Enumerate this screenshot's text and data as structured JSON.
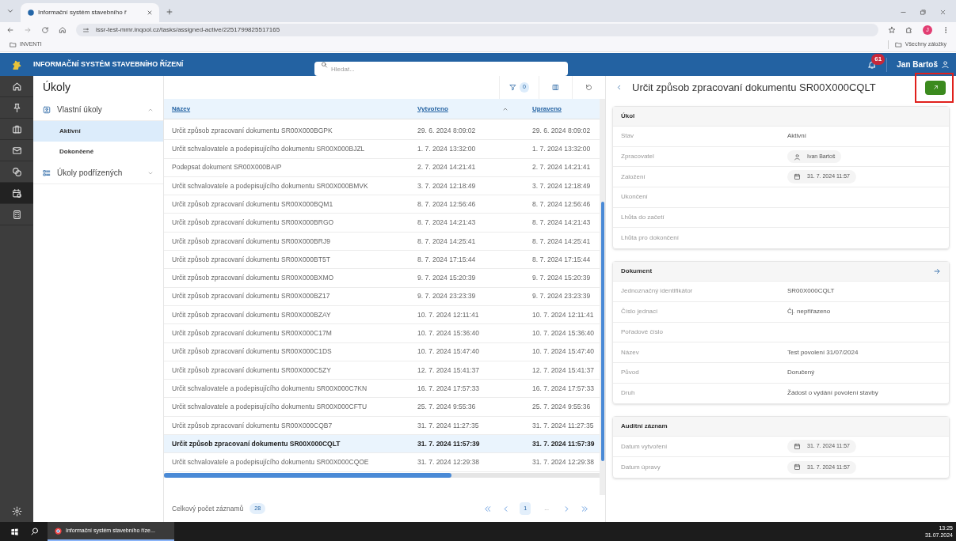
{
  "browser": {
    "tab_title": "Informační systém stavebního ř",
    "url": "issr-test-mmr.inqool.cz/tasks/assigned-active/2251799825517165",
    "bookmarks": [
      "INVENTI"
    ],
    "all_bookmarks": "Všechny záložky",
    "profile_initial": "J"
  },
  "app": {
    "title": "INFORMAČNÍ SYSTÉM STAVEBNÍHO ŘÍZENÍ",
    "search": {
      "placeholder": "Hledat..."
    },
    "notifications": "61",
    "user": "Jan Bartoš"
  },
  "rail": [
    {
      "selected": false
    },
    {
      "selected": false
    },
    {
      "selected": false
    },
    {
      "selected": false
    },
    {
      "selected": false
    },
    {
      "selected": true
    },
    {
      "selected": false
    }
  ],
  "sidebar": {
    "title": "Úkoly",
    "groups": [
      {
        "label": "Vlastní úkoly",
        "expanded": true,
        "children": [
          {
            "label": "Aktivní",
            "selected": true
          },
          {
            "label": "Dokončené",
            "selected": false
          }
        ]
      },
      {
        "label": "Úkoly podřízených",
        "expanded": false
      }
    ]
  },
  "toolbar": {
    "filter_count": "0"
  },
  "table": {
    "columns": [
      {
        "label": "Název",
        "sorted": false
      },
      {
        "label": "Vytvořeno",
        "sorted": true
      },
      {
        "label": "Upraveno",
        "sorted": false
      }
    ],
    "rows": [
      {
        "cells": [
          "Určit způsob zpracovaní dokumentu SR00X000BGPK",
          "29. 6. 2024 8:09:02",
          "29. 6. 2024 8:09:02"
        ],
        "selected": false
      },
      {
        "cells": [
          "Určit schvalovatele a podepisujícího dokumentu SR00X000BJZL",
          "1. 7. 2024 13:32:00",
          "1. 7. 2024 13:32:00"
        ],
        "selected": false
      },
      {
        "cells": [
          "Podepsat dokument SR00X000BAIP",
          "2. 7. 2024 14:21:41",
          "2. 7. 2024 14:21:41"
        ],
        "selected": false
      },
      {
        "cells": [
          "Určit schvalovatele a podepisujícího dokumentu SR00X000BMVK",
          "3. 7. 2024 12:18:49",
          "3. 7. 2024 12:18:49"
        ],
        "selected": false
      },
      {
        "cells": [
          "Určit způsob zpracovaní dokumentu SR00X000BQM1",
          "8. 7. 2024 12:56:46",
          "8. 7. 2024 12:56:46"
        ],
        "selected": false
      },
      {
        "cells": [
          "Určit způsob zpracovaní dokumentu SR00X000BRGO",
          "8. 7. 2024 14:21:43",
          "8. 7. 2024 14:21:43"
        ],
        "selected": false
      },
      {
        "cells": [
          "Určit způsob zpracovaní dokumentu SR00X000BRJ9",
          "8. 7. 2024 14:25:41",
          "8. 7. 2024 14:25:41"
        ],
        "selected": false
      },
      {
        "cells": [
          "Určit způsob zpracovaní dokumentu SR00X000BT5T",
          "8. 7. 2024 17:15:44",
          "8. 7. 2024 17:15:44"
        ],
        "selected": false
      },
      {
        "cells": [
          "Určit způsob zpracovaní dokumentu SR00X000BXMO",
          "9. 7. 2024 15:20:39",
          "9. 7. 2024 15:20:39"
        ],
        "selected": false
      },
      {
        "cells": [
          "Určit způsob zpracovaní dokumentu SR00X000BZ17",
          "9. 7. 2024 23:23:39",
          "9. 7. 2024 23:23:39"
        ],
        "selected": false
      },
      {
        "cells": [
          "Určit způsob zpracovaní dokumentu SR00X000BZAY",
          "10. 7. 2024 12:11:41",
          "10. 7. 2024 12:11:41"
        ],
        "selected": false
      },
      {
        "cells": [
          "Určit způsob zpracovaní dokumentu SR00X000C17M",
          "10. 7. 2024 15:36:40",
          "10. 7. 2024 15:36:40"
        ],
        "selected": false
      },
      {
        "cells": [
          "Určit způsob zpracovaní dokumentu SR00X000C1DS",
          "10. 7. 2024 15:47:40",
          "10. 7. 2024 15:47:40"
        ],
        "selected": false
      },
      {
        "cells": [
          "Určit způsob zpracovaní dokumentu SR00X000C5ZY",
          "12. 7. 2024 15:41:37",
          "12. 7. 2024 15:41:37"
        ],
        "selected": false
      },
      {
        "cells": [
          "Určit schvalovatele a podepisujícího dokumentu SR00X000C7KN",
          "16. 7. 2024 17:57:33",
          "16. 7. 2024 17:57:33"
        ],
        "selected": false
      },
      {
        "cells": [
          "Určit schvalovatele a podepisujícího dokumentu SR00X000CFTU",
          "25. 7. 2024 9:55:36",
          "25. 7. 2024 9:55:36"
        ],
        "selected": false
      },
      {
        "cells": [
          "Určit způsob zpracovaní dokumentu SR00X000CQB7",
          "31. 7. 2024 11:27:35",
          "31. 7. 2024 11:27:35"
        ],
        "selected": false
      },
      {
        "cells": [
          "Určit způsob zpracovaní dokumentu SR00X000CQLT",
          "31. 7. 2024 11:57:39",
          "31. 7. 2024 11:57:39"
        ],
        "selected": true
      },
      {
        "cells": [
          "Určit schvalovatele a podepisujícího dokumentu SR00X000CQOE",
          "31. 7. 2024 12:29:38",
          "31. 7. 2024 12:29:38"
        ],
        "selected": false
      }
    ]
  },
  "footer": {
    "total_label": "Celkový počet záznamů",
    "total": "28",
    "pages": [
      {
        "label": "1",
        "selected": true
      },
      {
        "label": "...",
        "selected": false
      }
    ]
  },
  "detail": {
    "title": "Určit způsob zpracovaní dokumentu SR00X000CQLT",
    "sections": [
      {
        "title": "Úkol",
        "link": false,
        "fields": [
          {
            "label": "Stav",
            "kind": "text",
            "value": "Aktivní"
          },
          {
            "label": "Zpracovatel",
            "kind": "person",
            "value": "Ivan Bartoš"
          },
          {
            "label": "Založení",
            "kind": "date",
            "value": "31. 7. 2024 11:57"
          },
          {
            "label": "Ukončení",
            "kind": "text"
          },
          {
            "label": "Lhůta do začetí",
            "kind": "text"
          },
          {
            "label": "Lhůta pro dokončení",
            "kind": "text"
          }
        ]
      },
      {
        "title": "Dokument",
        "link": true,
        "fields": [
          {
            "label": "Jednoznačný identifikátor",
            "kind": "text",
            "value": "SR00X000CQLT"
          },
          {
            "label": "Číslo jednací",
            "kind": "text",
            "value": "Čj. nepřiřazeno"
          },
          {
            "label": "Pořadové číslo",
            "kind": "text"
          },
          {
            "label": "Název",
            "kind": "text",
            "value": "Test povolení 31/07/2024"
          },
          {
            "label": "Původ",
            "kind": "text",
            "value": "Doručený"
          },
          {
            "label": "Druh",
            "kind": "text",
            "value": "Žádost o vydání povolení stavby"
          }
        ]
      },
      {
        "title": "Auditní záznam",
        "link": false,
        "fields": [
          {
            "label": "Datum vytvoření",
            "kind": "date",
            "value": "31. 7. 2024 11:57"
          },
          {
            "label": "Datum úpravy",
            "kind": "date",
            "value": "31. 7. 2024 11:57"
          }
        ]
      }
    ]
  },
  "taskbar": {
    "app": "Informační systém stavebního říze...",
    "time": "13:25",
    "date": "31.07.2024"
  }
}
